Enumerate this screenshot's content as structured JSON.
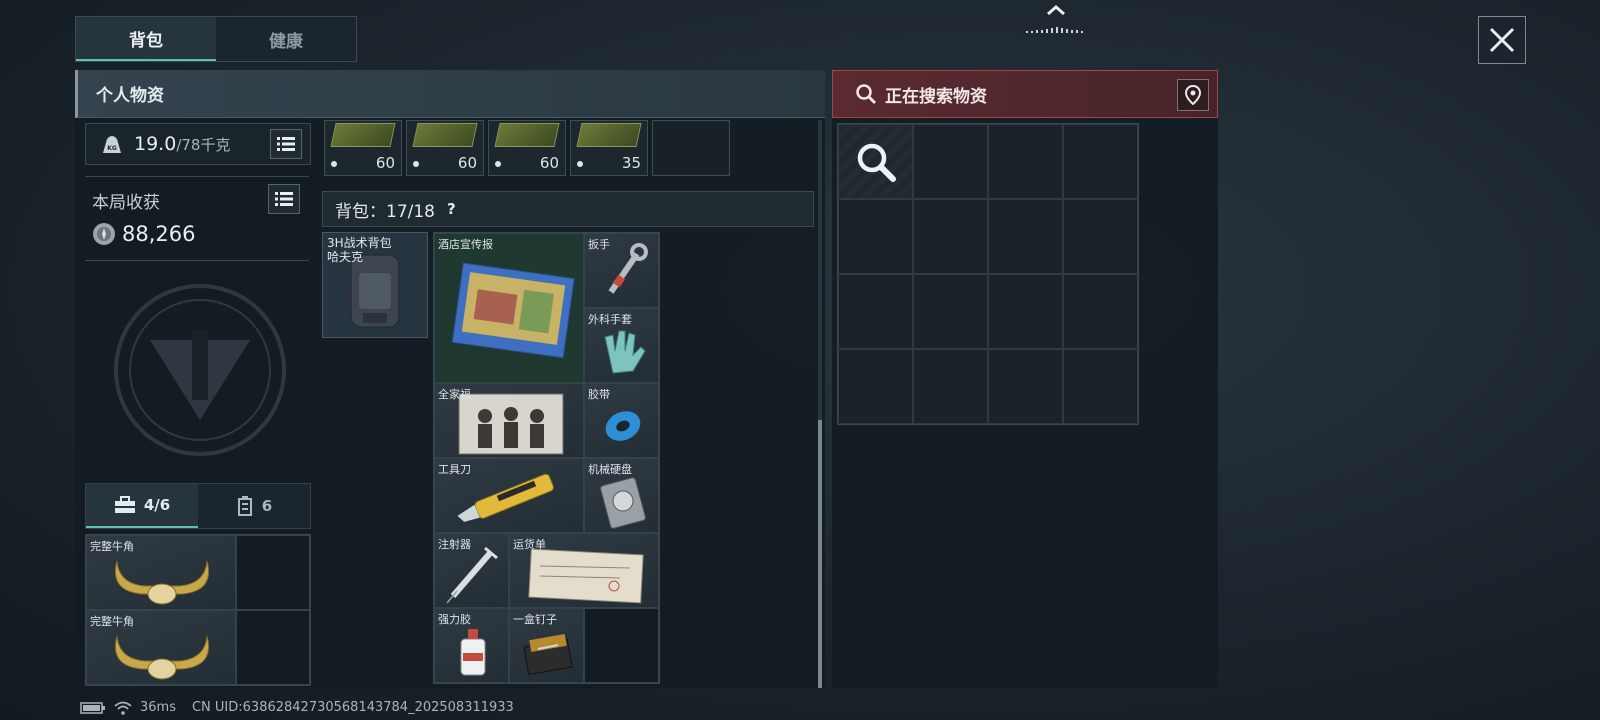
{
  "tabs": [
    {
      "label": "背包"
    },
    {
      "label": "健康"
    }
  ],
  "left_panel": {
    "title": "个人物资",
    "weight": {
      "current": "19.0",
      "max": "/78千克",
      "icon": "weight-kg-icon"
    },
    "loot": {
      "title": "本局收获",
      "value": "88,266",
      "icon": "coin-icon"
    },
    "sub_tabs": [
      {
        "label": "4/6",
        "icon": "toolbox-icon"
      },
      {
        "label": "6",
        "icon": "container-icon"
      }
    ],
    "safe_items": [
      {
        "label": "完整牛角"
      },
      {
        "label": "完整牛角"
      }
    ]
  },
  "ammo": [
    {
      "count": "60"
    },
    {
      "count": "60"
    },
    {
      "count": "60"
    },
    {
      "count": "35"
    }
  ],
  "bag": {
    "label": "背包：17/18",
    "help": "?",
    "backpack_label": "3H战术背包\n哈夫克",
    "items": [
      {
        "label": "酒店宣传报"
      },
      {
        "label": "扳手"
      },
      {
        "label": "外科手套"
      },
      {
        "label": "全家福"
      },
      {
        "label": "胶带"
      },
      {
        "label": "工具刀"
      },
      {
        "label": "机械硬盘"
      },
      {
        "label": "注射器"
      },
      {
        "label": "运货单"
      },
      {
        "label": "强力胶"
      },
      {
        "label": "一盒钉子"
      }
    ]
  },
  "right_panel": {
    "title": "正在搜索物资",
    "icon": "magnifier-icon",
    "location_icon": "location-pin-icon"
  },
  "status": {
    "ping": "36ms",
    "uid": "CN UID:63862842730568143784_202508311933"
  },
  "colors": {
    "accent": "#5ec3a6",
    "search_red": "#a0434b"
  }
}
